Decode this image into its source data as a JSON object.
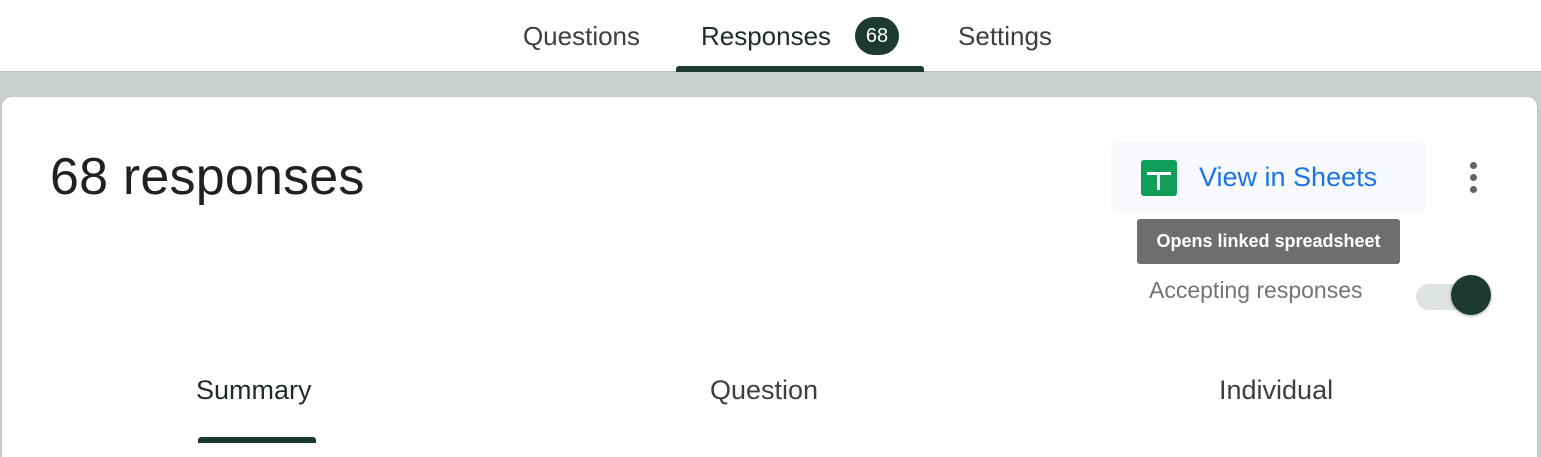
{
  "header": {
    "tabs": [
      {
        "label": "Questions"
      },
      {
        "label": "Responses",
        "badge": "68",
        "active": true
      },
      {
        "label": "Settings"
      }
    ]
  },
  "summary": {
    "title": "68 responses",
    "view_in_sheets": "View in Sheets",
    "tooltip": "Opens linked spreadsheet",
    "accepting_label": "Accepting responses",
    "accepting_on": true
  },
  "subtabs": [
    {
      "label": "Summary",
      "active": true
    },
    {
      "label": "Question"
    },
    {
      "label": "Individual"
    }
  ],
  "icons": {
    "sheets": "google-sheets-icon",
    "more": "more-vert-icon"
  },
  "colors": {
    "accent": "#1d3a31",
    "link": "#1a73e8",
    "sheets_green": "#0f9d58",
    "tooltip_bg": "#6e6e6e"
  }
}
